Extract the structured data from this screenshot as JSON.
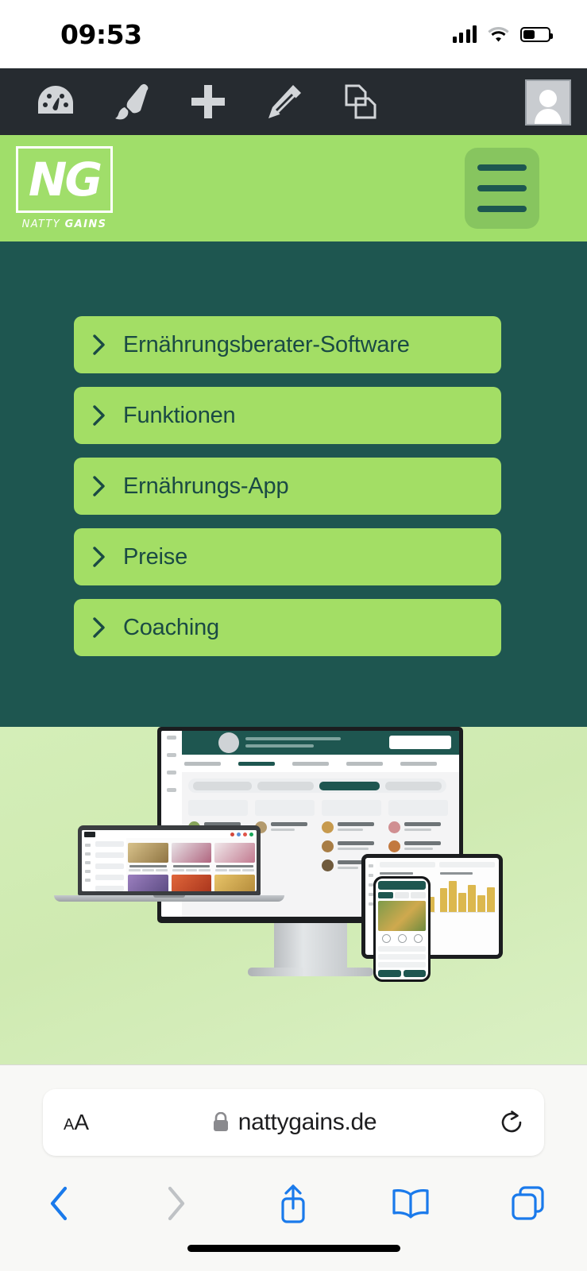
{
  "status_bar": {
    "time": "09:53",
    "signal_icon": "cellular-bars-icon",
    "wifi_icon": "wifi-icon",
    "battery_icon": "battery-icon",
    "battery_level_percent": 40
  },
  "app_toolbar": {
    "background_color": "#262b30",
    "tools": [
      {
        "name": "dashboard-icon",
        "label": "Dashboard"
      },
      {
        "name": "paintbrush-icon",
        "label": "Brush"
      },
      {
        "name": "plus-icon",
        "label": "Add"
      },
      {
        "name": "pencil-icon",
        "label": "Edit"
      },
      {
        "name": "duplicate-icon",
        "label": "Duplicate"
      }
    ],
    "avatar": {
      "name": "avatar",
      "label": "Profile"
    }
  },
  "site_header": {
    "background_color": "#a0de6a",
    "logo": {
      "mark": "NG",
      "wordmark_light": "NATTY ",
      "wordmark_bold": "GAINS"
    },
    "menu_button": {
      "name": "hamburger-menu-button",
      "label": "Menu",
      "bar_color": "#1d5750"
    }
  },
  "nav_panel": {
    "background_color": "#1e5650",
    "item_background_color": "#a3de65",
    "item_text_color": "#1a4a44",
    "items": [
      {
        "label": "Ernährungsberater-Software"
      },
      {
        "label": "Funktionen"
      },
      {
        "label": "Ernährungs-App"
      },
      {
        "label": "Preise"
      },
      {
        "label": "Coaching"
      }
    ]
  },
  "hero": {
    "background_colors": [
      "#d4eeb8",
      "#daf0c4"
    ],
    "alt": "Produkt-Mockup: Desktop, Laptop, Tablet und Smartphone mit Ernährungsberater-Software",
    "devices": [
      "monitor",
      "laptop",
      "tablet",
      "smartphone"
    ],
    "accent_color": "#1e5650"
  },
  "browser_bar": {
    "text_size_label": "AA",
    "lock_icon": "lock-icon",
    "url": "nattygains.de",
    "reload_icon": "reload-icon",
    "nav": [
      {
        "name": "back-button",
        "icon": "chevron-left-icon",
        "enabled": true
      },
      {
        "name": "forward-button",
        "icon": "chevron-right-icon",
        "enabled": false
      },
      {
        "name": "share-button",
        "icon": "share-icon",
        "enabled": true
      },
      {
        "name": "bookmarks-button",
        "icon": "book-icon",
        "enabled": true
      },
      {
        "name": "tabs-button",
        "icon": "tabs-icon",
        "enabled": true
      }
    ],
    "accent_color": "#1a7aeb"
  }
}
